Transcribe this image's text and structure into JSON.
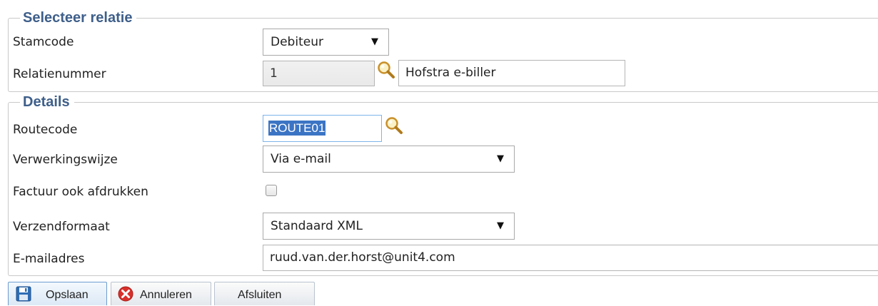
{
  "relation": {
    "legend": "Selecteer relatie",
    "stamcode_label": "Stamcode",
    "stamcode_value": "Debiteur",
    "relatienummer_label": "Relatienummer",
    "relatienummer_value": "1",
    "relation_name": "Hofstra e-biller"
  },
  "details": {
    "legend": "Details",
    "routecode_label": "Routecode",
    "routecode_value": "ROUTE01",
    "verwerkingswijze_label": "Verwerkingswijze",
    "verwerkingswijze_value": "Via e-mail",
    "factuur_label": "Factuur ook afdrukken",
    "factuur_checked": false,
    "verzendformaat_label": "Verzendformaat",
    "verzendformaat_value": "Standaard XML",
    "email_label": "E-mailadres",
    "email_value": "ruud.van.der.horst@unit4.com"
  },
  "toolbar": {
    "save_label": "Opslaan",
    "cancel_label": "Annuleren",
    "close_label": "Afsluiten"
  },
  "icons": {
    "lookup": "magnifier-icon",
    "save": "floppy-disk-icon",
    "cancel": "red-x-circle-icon",
    "dropdown": "triangle-down-icon"
  },
  "colors": {
    "legend": "#3e5f8a",
    "selection": "#3b74c4",
    "cancel_icon": "#d9302b"
  }
}
